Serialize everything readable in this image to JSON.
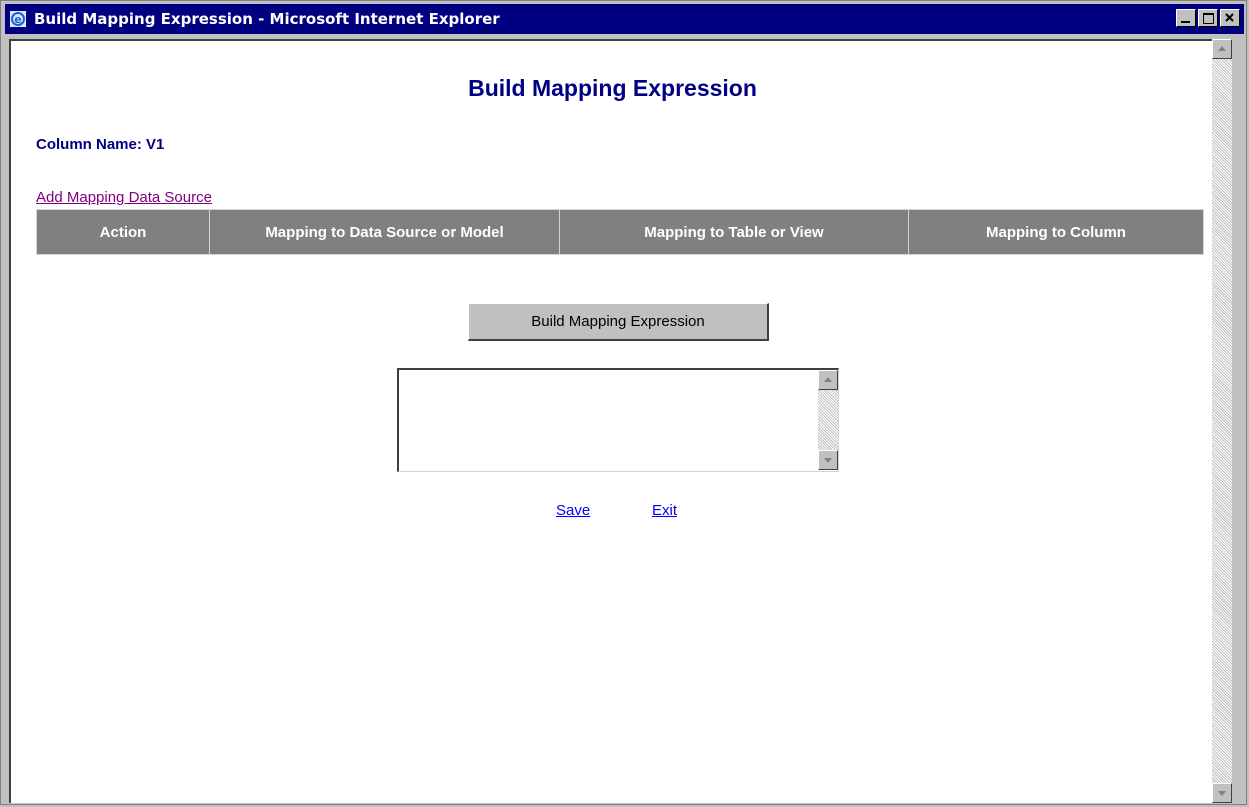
{
  "window": {
    "title": "Build Mapping Expression - Microsoft Internet Explorer",
    "titlebar_color": "#000080"
  },
  "page": {
    "heading": "Build Mapping Expression",
    "column_name_label": "Column Name: V1",
    "add_link": "Add Mapping Data Source",
    "table_headers": [
      "Action",
      "Mapping to Data Source or Model",
      "Mapping to Table or View",
      "Mapping to Column"
    ],
    "build_button": "Build Mapping Expression",
    "expression_value": "",
    "save_link": "Save",
    "exit_link": "Exit"
  },
  "colors": {
    "heading": "#000080",
    "visited_link": "#800080",
    "link": "#0000ff",
    "table_header_bg": "#808080"
  }
}
